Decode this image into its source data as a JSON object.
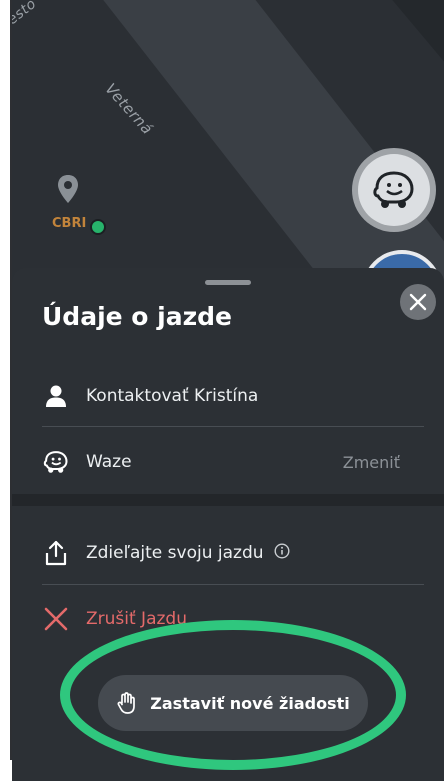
{
  "map": {
    "street_top": "esto",
    "street_main": "Veterná",
    "poi_label": "CBRI",
    "icons": {
      "pin": "map-pin-icon",
      "waze_fab": "waze-icon"
    }
  },
  "sheet": {
    "title": "Údaje o jazde",
    "close_icon": "close-icon",
    "rows": {
      "contact": {
        "label": "Kontaktovať Kristína",
        "icon": "person-icon"
      },
      "navigation": {
        "label": "Waze",
        "action": "Zmeniť",
        "icon": "waze-icon"
      },
      "share": {
        "label": "Zdieľajte svoju jazdu",
        "icon": "share-icon",
        "info_icon": "info-icon"
      },
      "cancel": {
        "label": "Zrušiť Jazdu",
        "icon": "x-icon"
      }
    },
    "stop_button": {
      "label": "Zastaviť nové žiadosti",
      "icon": "hand-icon"
    }
  },
  "colors": {
    "background": "#2c3035",
    "accent_cancel": "#e46a6a",
    "annotation": "#2fc77e"
  }
}
